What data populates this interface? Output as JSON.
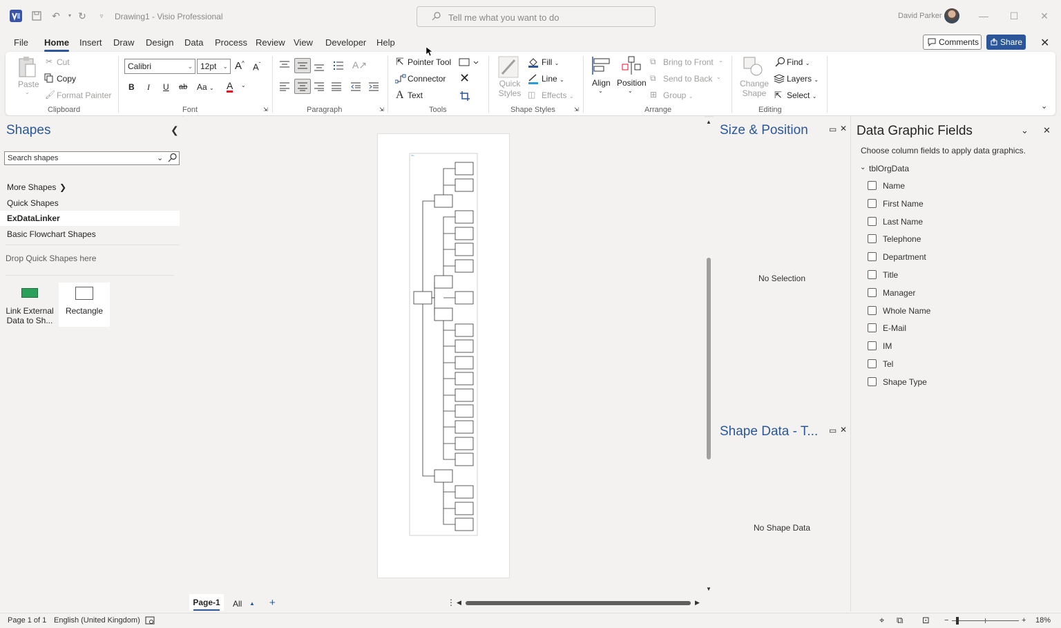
{
  "titlebar": {
    "doc_title": "Drawing1  -  Visio Professional",
    "search_placeholder": "Tell me what you want to do",
    "user_name": "David Parker"
  },
  "menu": {
    "tabs": [
      "File",
      "Home",
      "Insert",
      "Draw",
      "Design",
      "Data",
      "Process",
      "Review",
      "View",
      "Developer",
      "Help"
    ],
    "active": "Home",
    "comments": "Comments",
    "share": "Share"
  },
  "ribbon": {
    "clipboard": {
      "label": "Clipboard",
      "paste": "Paste",
      "cut": "Cut",
      "copy": "Copy",
      "format_painter": "Format Painter"
    },
    "font": {
      "label": "Font",
      "family": "Calibri",
      "size": "12pt",
      "bold": "B",
      "italic": "I",
      "underline": "U",
      "strike": "ab",
      "case": "Aa",
      "color_letter": "A",
      "grow": "A",
      "shrink": "A"
    },
    "paragraph": {
      "label": "Paragraph"
    },
    "tools": {
      "label": "Tools",
      "pointer": "Pointer Tool",
      "connector": "Connector",
      "text": "Text"
    },
    "shape_styles": {
      "label": "Shape Styles",
      "quick_styles": "Quick Styles",
      "fill": "Fill",
      "line": "Line",
      "effects": "Effects"
    },
    "arrange": {
      "label": "Arrange",
      "align": "Align",
      "position": "Position",
      "bring_front": "Bring to Front",
      "send_back": "Send to Back",
      "group": "Group"
    },
    "editing": {
      "label": "Editing",
      "change_shape": "Change Shape",
      "find": "Find",
      "layers": "Layers",
      "select": "Select"
    }
  },
  "shapes_pane": {
    "title": "Shapes",
    "search_placeholder": "Search shapes",
    "items": [
      "More Shapes",
      "Quick Shapes",
      "ExDataLinker",
      "Basic Flowchart Shapes"
    ],
    "selected": "ExDataLinker",
    "drop_hint": "Drop Quick Shapes here",
    "masters": [
      {
        "label": "Link External Data to Sh...",
        "label_line1": "Link  External",
        "label_line2": "Data to Sh..."
      },
      {
        "label": "Rectangle"
      }
    ]
  },
  "size_position": {
    "title": "Size & Position",
    "message": "No Selection"
  },
  "shape_data": {
    "title": "Shape Data - T...",
    "message": "No Shape Data"
  },
  "data_graphic_fields": {
    "title": "Data Graphic Fields",
    "description": "Choose column fields to apply data graphics.",
    "table": "tblOrgData",
    "fields": [
      "Name",
      "First Name",
      "Last Name",
      "Telephone",
      "Department",
      "Title",
      "Manager",
      "Whole Name",
      "E-Mail",
      "IM",
      "Tel",
      "Shape Type"
    ]
  },
  "page_tabs": {
    "current": "Page-1",
    "all": "All"
  },
  "statusbar": {
    "page": "Page 1 of 1",
    "language": "English (United Kingdom)",
    "zoom": "18%"
  },
  "colors": {
    "accent": "#2b579a",
    "visio_icon": "#3955a3"
  }
}
